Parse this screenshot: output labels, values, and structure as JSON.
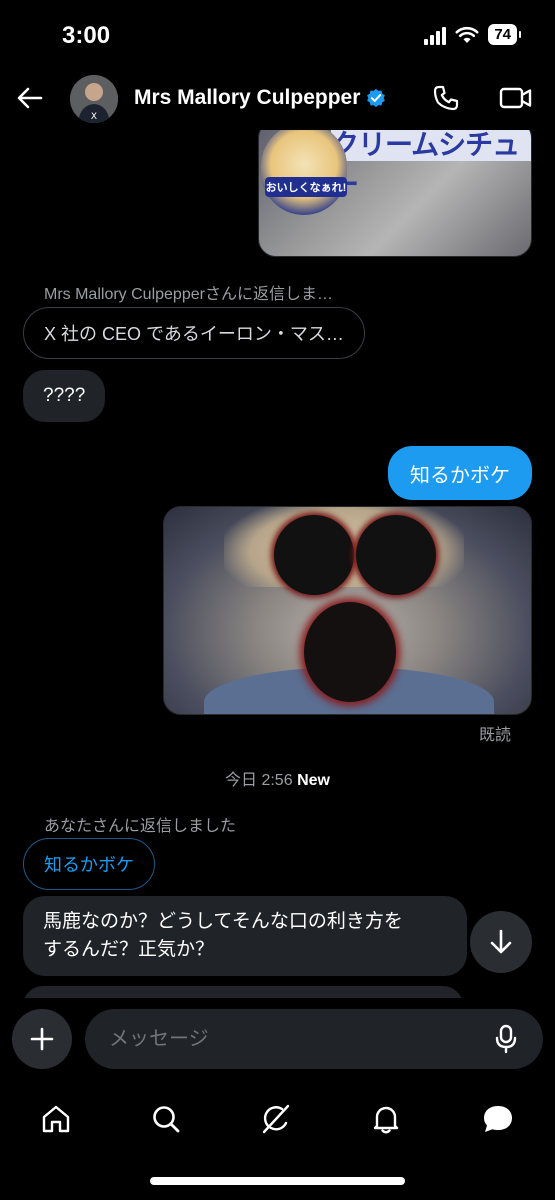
{
  "status": {
    "time": "3:00",
    "battery": "74"
  },
  "header": {
    "name": "Mrs Mallory Culpepper"
  },
  "messages": {
    "media1_banner": "クリームシチュー",
    "media1_badge": "おいしくなぁれ!",
    "reply_label_1": "Mrs Mallory Culpepperさんに返信しま…",
    "quoted_1": "X 社の CEO であるイーロン・マス…",
    "incoming_1": "????",
    "outgoing_1": "知るかボケ",
    "read_label": "既読",
    "date_label": "今日 2:56",
    "new_label": "New",
    "reply_label_2": "あなたさんに返信しました",
    "quoted_2": "知るかボケ",
    "incoming_2_line1": "馬鹿なのか？どうしてそんな口の利き方を",
    "incoming_2_line2": "するんだ？正気か？"
  },
  "composer": {
    "placeholder": "メッセージ"
  },
  "tabs": [
    "home",
    "search",
    "grok",
    "notifications",
    "messages"
  ],
  "colors": {
    "accent": "#1d9bf0",
    "bubble_in": "#202327",
    "background": "#000000"
  }
}
